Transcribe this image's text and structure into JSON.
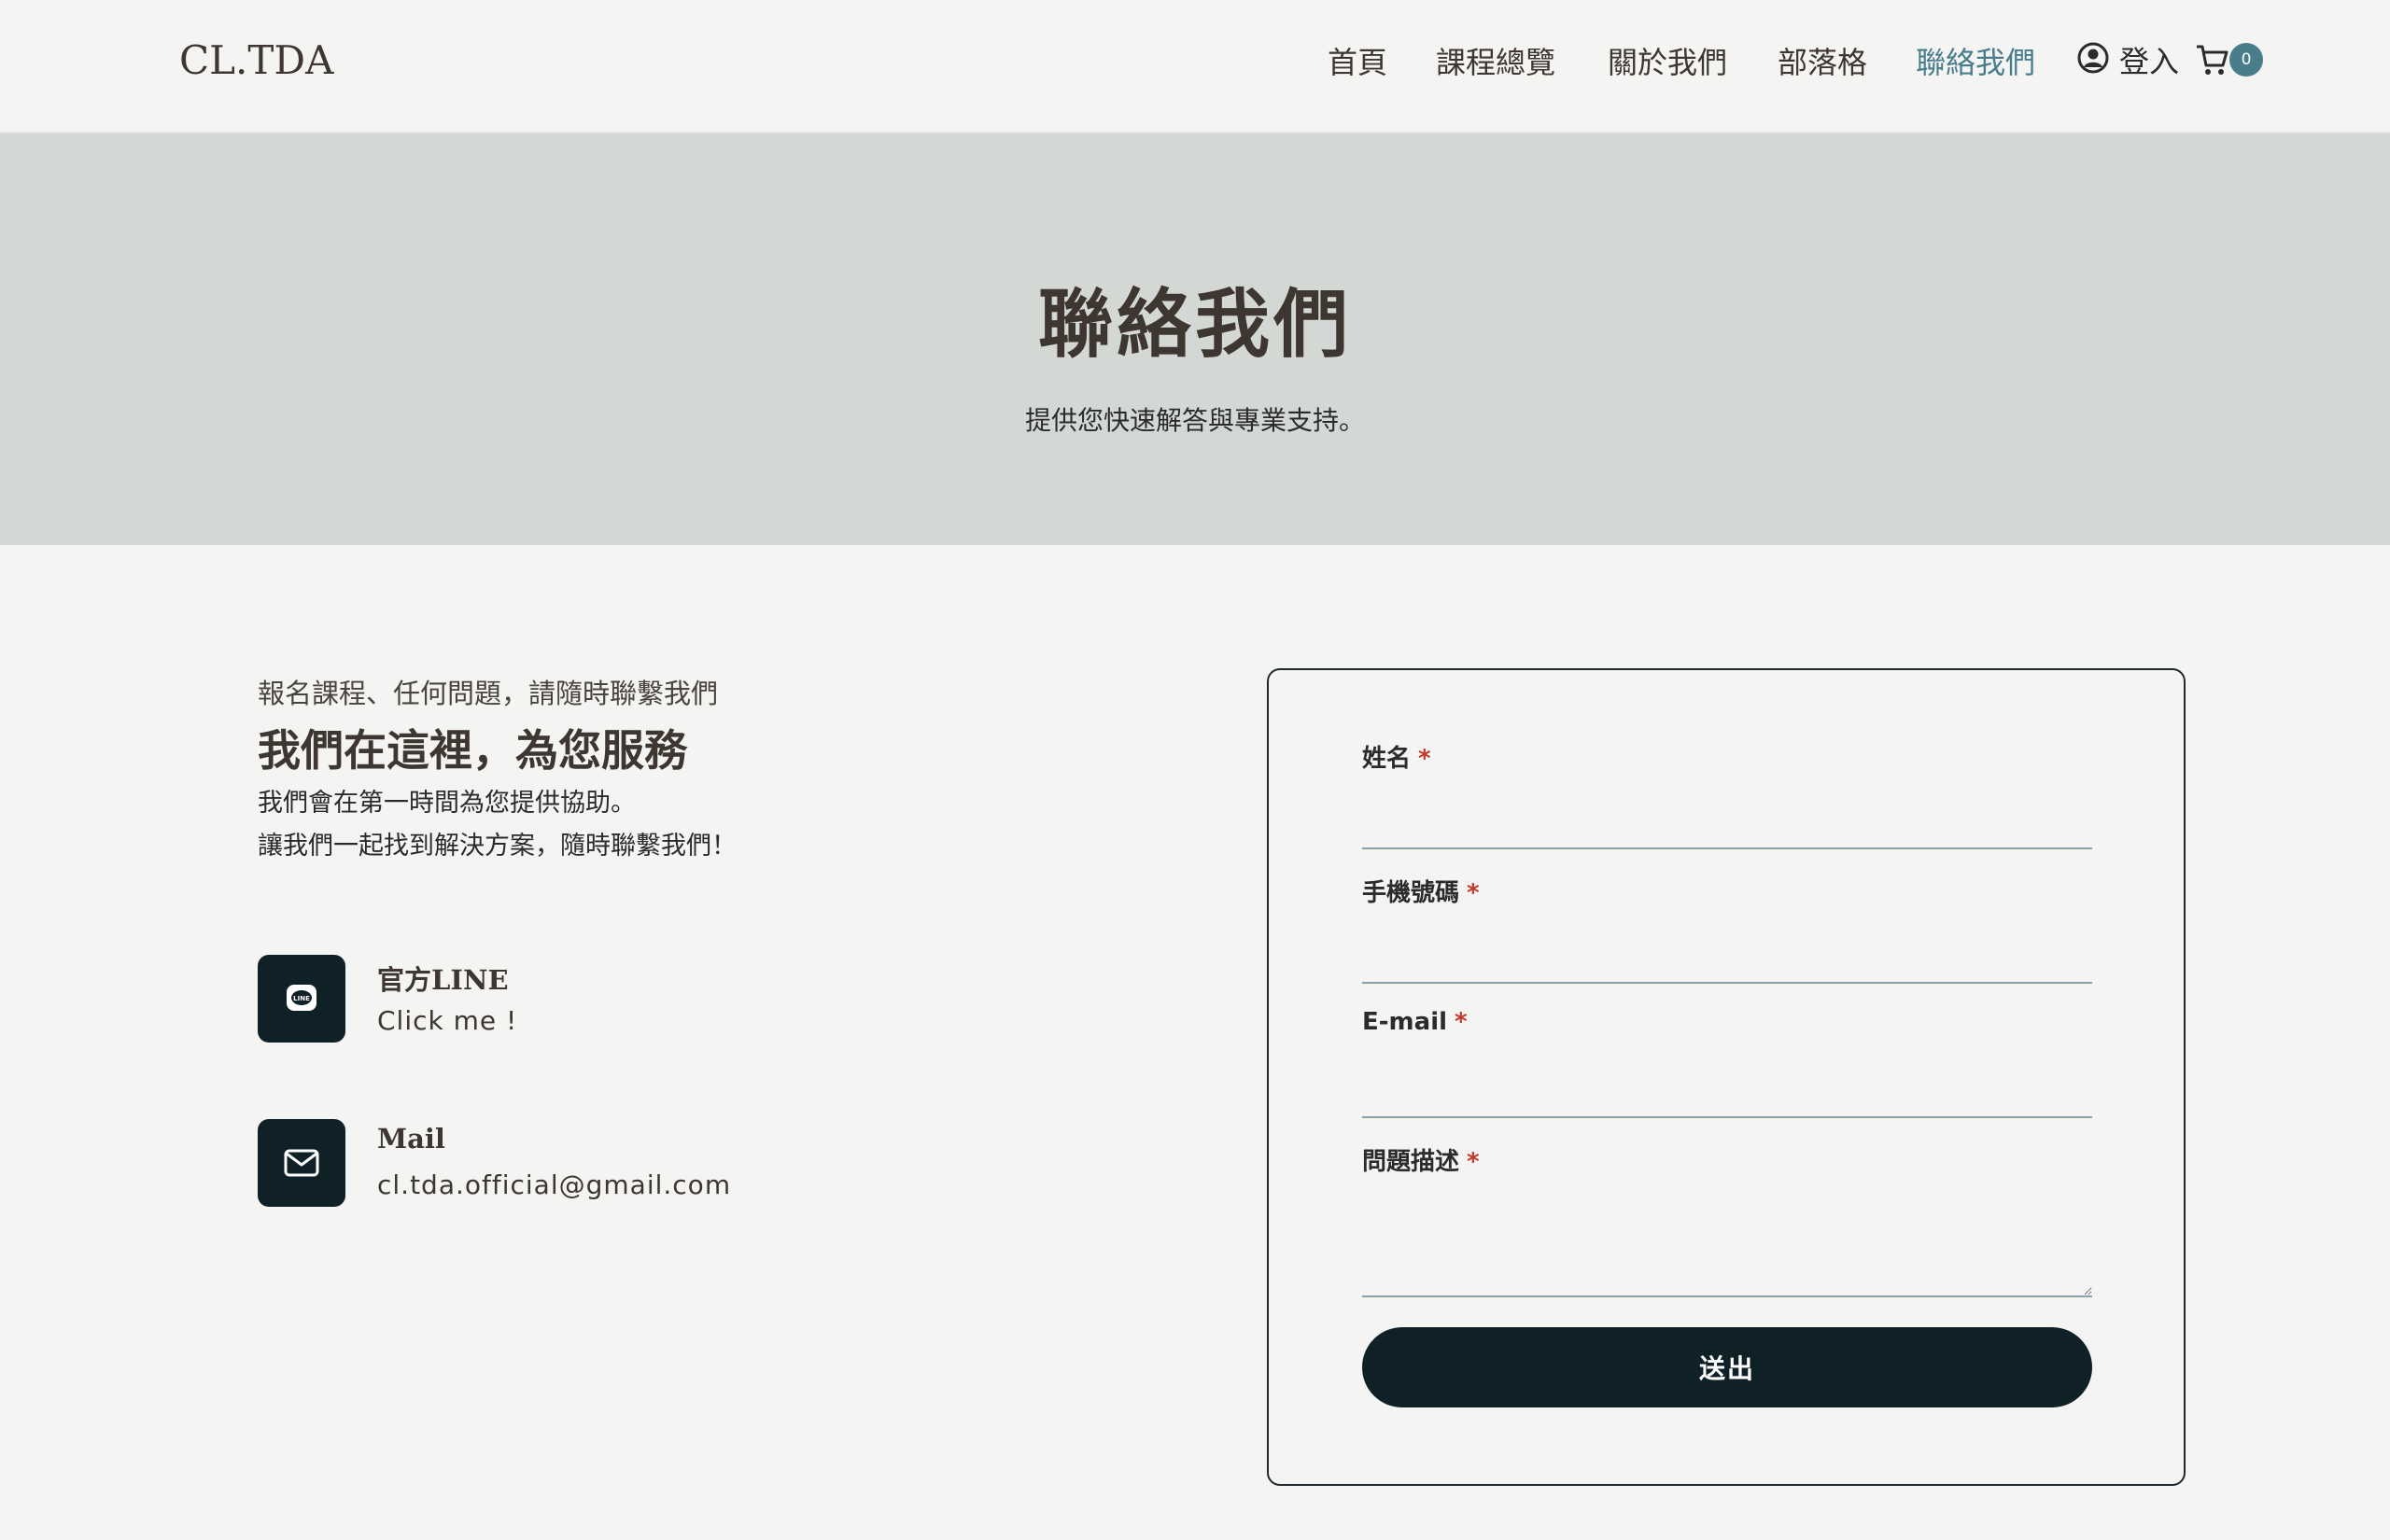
{
  "header": {
    "logo": "CL.TDA",
    "nav": [
      {
        "label": "首頁"
      },
      {
        "label": "課程總覽"
      },
      {
        "label": "關於我們"
      },
      {
        "label": "部落格"
      },
      {
        "label": "聯絡我們",
        "active": true
      }
    ],
    "login_label": "登入",
    "cart_count": "0"
  },
  "hero": {
    "title": "聯絡我們",
    "subtitle": "提供您快速解答與專業支持。"
  },
  "info": {
    "eyebrow": "報名課程、任何問題，請隨時聯繫我們",
    "headline": "我們在這裡，為您服務",
    "desc_line1": "我們會在第一時間為您提供協助。",
    "desc_line2": "讓我們一起找到解決方案，隨時聯繫我們！",
    "line": {
      "title": "官方LINE",
      "value": "Click me !"
    },
    "mail": {
      "title": "Mail",
      "value": "cl.tda.official@gmail.com"
    }
  },
  "form": {
    "name_label": "姓名",
    "phone_label": "手機號碼",
    "email_label": "E-mail",
    "question_label": "問題描述",
    "required_mark": "*",
    "submit_label": "送出"
  },
  "colors": {
    "accent": "#4a7d8c",
    "dark": "#0f2027",
    "hero_bg": "#d4d8d4",
    "required": "#c0392b"
  }
}
